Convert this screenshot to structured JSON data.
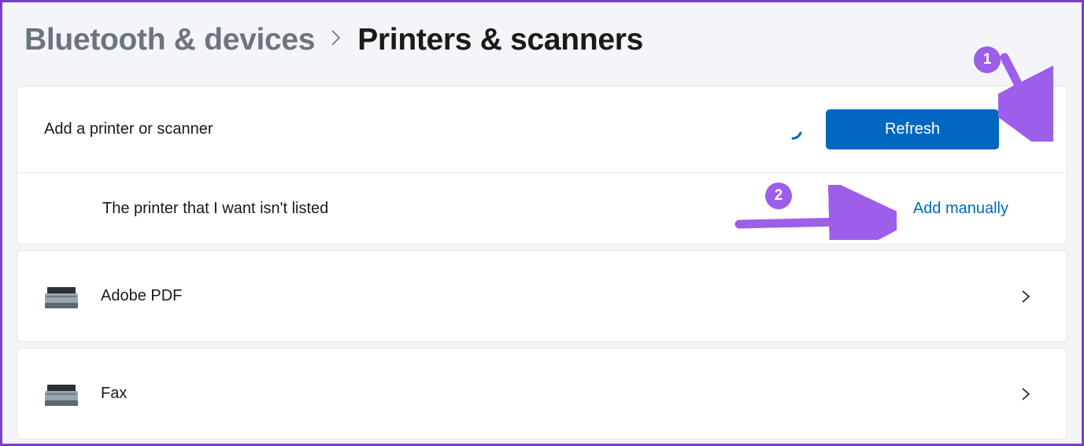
{
  "breadcrumb": {
    "parent": "Bluetooth & devices",
    "current": "Printers & scanners"
  },
  "add_section": {
    "label": "Add a printer or scanner",
    "refresh_button": "Refresh",
    "not_listed_label": "The printer that I want isn't listed",
    "add_manually_label": "Add manually"
  },
  "devices": [
    {
      "name": "Adobe PDF"
    },
    {
      "name": "Fax"
    }
  ],
  "annotations": {
    "badge_1": "1",
    "badge_2": "2"
  }
}
